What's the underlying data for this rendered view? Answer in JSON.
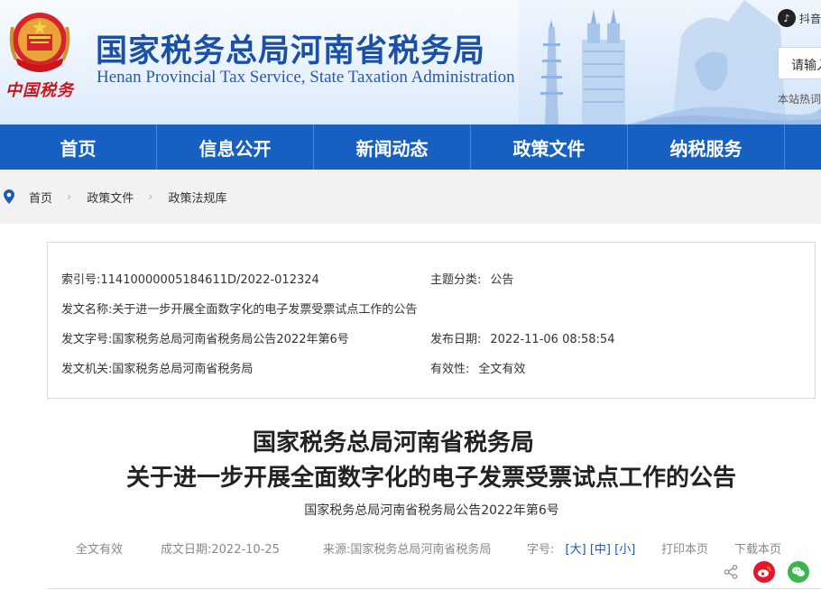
{
  "header": {
    "title_cn": "国家税务总局河南省税务局",
    "title_en": "Henan Provincial Tax Service, State Taxation Administration",
    "brand_script": "中国税务",
    "douyin_label": "抖音",
    "search_placeholder": "请输入",
    "hot_words_label": "本站热词"
  },
  "nav": {
    "items": [
      "首页",
      "信息公开",
      "新闻动态",
      "政策文件",
      "纳税服务"
    ]
  },
  "breadcrumb": {
    "items": [
      "首页",
      "政策文件",
      "政策法规库"
    ]
  },
  "meta": {
    "index_no_label": "索引号:",
    "index_no": "11410000005184611D/2022-012324",
    "category_label": "主题分类:",
    "category": "公告",
    "doc_name_label": "发文名称:",
    "doc_name": "关于进一步开展全面数字化的电子发票受票试点工作的公告",
    "doc_code_label": "发文字号:",
    "doc_code": "国家税务总局河南省税务局公告2022年第6号",
    "publish_date_label": "发布日期:",
    "publish_date": "2022-11-06 08:58:54",
    "issuer_label": "发文机关:",
    "issuer": "国家税务总局河南省税务局",
    "validity_label": "有效性:",
    "validity": "全文有效"
  },
  "article": {
    "title_line1": "国家税务总局河南省税务局",
    "title_line2": "关于进一步开展全面数字化的电子发票受票试点工作的公告",
    "doc_number": "国家税务总局河南省税务局公告2022年第6号"
  },
  "info_bar": {
    "validity": "全文有效",
    "date": "成文日期:2022-10-25",
    "source": "来源:国家税务总局河南省税务局",
    "font_size_label": "字号:",
    "size_large": "[大]",
    "size_medium": "[中]",
    "size_small": "[小]",
    "print": "打印本页",
    "download": "下载本页"
  },
  "colors": {
    "nav_bg": "#1760c2",
    "title_blue": "#1c4fa6",
    "weibo_red": "#e6162d",
    "wechat_green": "#3fb34f"
  }
}
